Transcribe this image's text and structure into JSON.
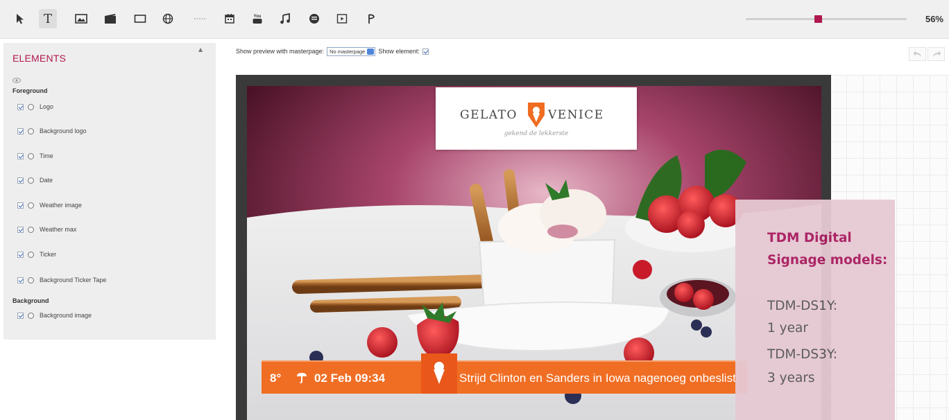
{
  "toolbar": {
    "tools": [
      "pointer-tool",
      "text-tool",
      "image-tool",
      "video-tool",
      "shape-tool",
      "web-tool",
      "divider",
      "calendar-tool",
      "youtube-tool",
      "music-tool",
      "rss-tool",
      "playlist-tool",
      "widget-tool"
    ],
    "zoom": {
      "label": "56%",
      "value": 0.43
    }
  },
  "panel": {
    "title": "ELEMENTS",
    "groups": [
      {
        "label": "Foreground",
        "items": [
          "Logo",
          "Background logo",
          "Time",
          "Date",
          "Weather image",
          "Weather max",
          "Ticker",
          "Background Ticker Tape"
        ]
      },
      {
        "label": "Background",
        "items": [
          "Background image"
        ]
      }
    ]
  },
  "preview_options": {
    "masterpage_label": "Show preview with masterpage:",
    "masterpage_value": "No masterpage",
    "show_element_label": "Show element:"
  },
  "preview": {
    "logo": {
      "left": "GELATO",
      "right": "VENICE",
      "tagline": "gekend de lekkerste"
    },
    "ticker": {
      "temperature": "8°",
      "datetime": "02 Feb 09:34",
      "headline": "Strijd Clinton en Sanders in Iowa nagenoeg onbeslist"
    }
  },
  "info": {
    "title": "TDM Digital Signage models:",
    "lines": [
      "TDM-DS1Y:",
      "1 year",
      "TDM-DS3Y:",
      "3 years"
    ]
  },
  "colors": {
    "accent": "#b0174e",
    "ticker": "#f06e24",
    "info_bg": "#e6c9d3",
    "info_title": "#a91c5f"
  }
}
